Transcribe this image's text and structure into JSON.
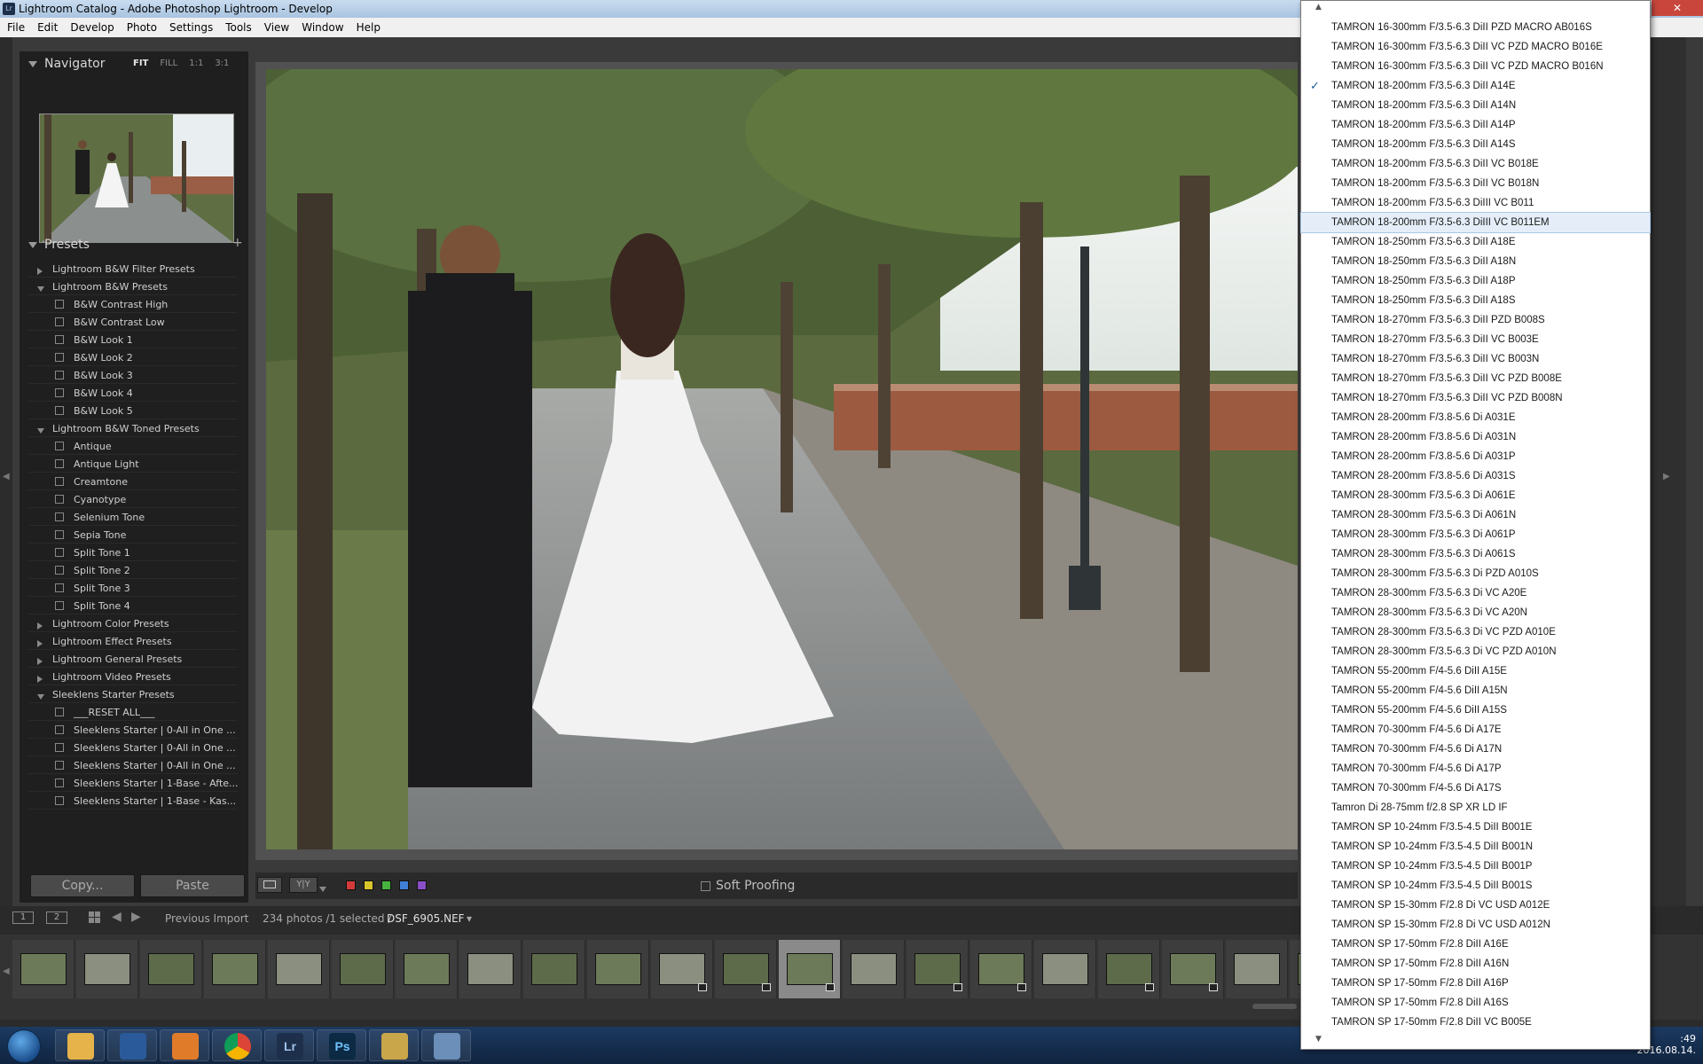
{
  "window": {
    "title": "Lightroom Catalog - Adobe Photoshop Lightroom - Develop",
    "app_icon": "Lr",
    "close_glyph": "✕"
  },
  "menu": [
    "File",
    "Edit",
    "Develop",
    "Photo",
    "Settings",
    "Tools",
    "View",
    "Window",
    "Help"
  ],
  "navigator": {
    "title": "Navigator",
    "modes": [
      "FIT",
      "FILL",
      "1:1",
      "3:1"
    ],
    "active_mode": "FIT"
  },
  "presets": {
    "title": "Presets",
    "add_glyph": "+",
    "rows": [
      {
        "kind": "folder",
        "open": false,
        "label": "Lightroom B&W Filter Presets"
      },
      {
        "kind": "folder",
        "open": true,
        "label": "Lightroom B&W Presets"
      },
      {
        "kind": "item",
        "label": "B&W Contrast High"
      },
      {
        "kind": "item",
        "label": "B&W Contrast Low"
      },
      {
        "kind": "item",
        "label": "B&W Look 1"
      },
      {
        "kind": "item",
        "label": "B&W Look 2"
      },
      {
        "kind": "item",
        "label": "B&W Look 3"
      },
      {
        "kind": "item",
        "label": "B&W Look 4"
      },
      {
        "kind": "item",
        "label": "B&W Look 5"
      },
      {
        "kind": "folder",
        "open": true,
        "label": "Lightroom B&W Toned Presets"
      },
      {
        "kind": "item",
        "label": "Antique"
      },
      {
        "kind": "item",
        "label": "Antique Light"
      },
      {
        "kind": "item",
        "label": "Creamtone"
      },
      {
        "kind": "item",
        "label": "Cyanotype"
      },
      {
        "kind": "item",
        "label": "Selenium Tone"
      },
      {
        "kind": "item",
        "label": "Sepia Tone"
      },
      {
        "kind": "item",
        "label": "Split Tone 1"
      },
      {
        "kind": "item",
        "label": "Split Tone 2"
      },
      {
        "kind": "item",
        "label": "Split Tone 3"
      },
      {
        "kind": "item",
        "label": "Split Tone 4"
      },
      {
        "kind": "folder",
        "open": false,
        "label": "Lightroom Color Presets"
      },
      {
        "kind": "folder",
        "open": false,
        "label": "Lightroom Effect Presets"
      },
      {
        "kind": "folder",
        "open": false,
        "label": "Lightroom General Presets"
      },
      {
        "kind": "folder",
        "open": false,
        "label": "Lightroom Video Presets"
      },
      {
        "kind": "folder",
        "open": true,
        "label": "Sleeklens Starter Presets"
      },
      {
        "kind": "item",
        "label": "___RESET ALL___"
      },
      {
        "kind": "item",
        "label": "Sleeklens Starter | 0-All in One ..."
      },
      {
        "kind": "item",
        "label": "Sleeklens Starter | 0-All in One ..."
      },
      {
        "kind": "item",
        "label": "Sleeklens Starter | 0-All in One ..."
      },
      {
        "kind": "item",
        "label": "Sleeklens Starter | 1-Base - Afte..."
      },
      {
        "kind": "item",
        "label": "Sleeklens Starter | 1-Base - Kas..."
      }
    ]
  },
  "buttons": {
    "copy": "Copy...",
    "paste": "Paste"
  },
  "toolbar": {
    "soft_proofing": "Soft Proofing",
    "view_yy": "Y|Y",
    "color_labels": [
      "#d33a3a",
      "#d8c52a",
      "#47b23e",
      "#3f7fd6",
      "#8a4fc8"
    ]
  },
  "filmstrip_bar": {
    "screen1": "1",
    "screen2": "2",
    "source": "Previous Import",
    "count": "234 photos /1 selected /",
    "filename": "DSF_6905.NEF",
    "dropdown_glyph": "▾"
  },
  "filmstrip": {
    "selected_index": 12,
    "badged": [
      10,
      11,
      12,
      14,
      15,
      17,
      18
    ]
  },
  "clock": {
    "time": ":49",
    "date": "2016.08.14."
  },
  "taskbar_icons": [
    "folder-icon",
    "save-icon",
    "media-player-icon",
    "chrome-icon",
    "lightroom-icon",
    "photoshop-icon",
    "paint-icon",
    "screenshot-icon"
  ],
  "taskbar_labels": {
    "lightroom": "Lr",
    "photoshop": "Ps"
  },
  "lens_dropdown": {
    "checked_index": 3,
    "hover_index": 10,
    "items": [
      "TAMRON 16-300mm F/3.5-6.3 DiII PZD MACRO AB016S",
      "TAMRON 16-300mm F/3.5-6.3 DiII VC PZD MACRO B016E",
      "TAMRON 16-300mm F/3.5-6.3 DiII VC PZD MACRO B016N",
      "TAMRON 18-200mm F/3.5-6.3 DiII A14E",
      "TAMRON 18-200mm F/3.5-6.3 DiII A14N",
      "TAMRON 18-200mm F/3.5-6.3 DiII A14P",
      "TAMRON 18-200mm F/3.5-6.3 DiII A14S",
      "TAMRON 18-200mm F/3.5-6.3 DiII VC B018E",
      "TAMRON 18-200mm F/3.5-6.3 DiII VC B018N",
      "TAMRON 18-200mm F/3.5-6.3 DiIII VC B011",
      "TAMRON 18-200mm F/3.5-6.3 DiIII VC B011EM",
      "TAMRON 18-250mm F/3.5-6.3 DiII A18E",
      "TAMRON 18-250mm F/3.5-6.3 DiII A18N",
      "TAMRON 18-250mm F/3.5-6.3 DiII A18P",
      "TAMRON 18-250mm F/3.5-6.3 DiII A18S",
      "TAMRON 18-270mm F/3.5-6.3 DiII PZD B008S",
      "TAMRON 18-270mm F/3.5-6.3 DiII VC B003E",
      "TAMRON 18-270mm F/3.5-6.3 DiII VC B003N",
      "TAMRON 18-270mm F/3.5-6.3 DiII VC PZD B008E",
      "TAMRON 18-270mm F/3.5-6.3 DiII VC PZD B008N",
      "TAMRON 28-200mm F/3.8-5.6 Di A031E",
      "TAMRON 28-200mm F/3.8-5.6 Di A031N",
      "TAMRON 28-200mm F/3.8-5.6 Di A031P",
      "TAMRON 28-200mm F/3.8-5.6 Di A031S",
      "TAMRON 28-300mm F/3.5-6.3 Di A061E",
      "TAMRON 28-300mm F/3.5-6.3 Di A061N",
      "TAMRON 28-300mm F/3.5-6.3 Di A061P",
      "TAMRON 28-300mm F/3.5-6.3 Di A061S",
      "TAMRON 28-300mm F/3.5-6.3 Di PZD A010S",
      "TAMRON 28-300mm F/3.5-6.3 Di VC A20E",
      "TAMRON 28-300mm F/3.5-6.3 Di VC A20N",
      "TAMRON 28-300mm F/3.5-6.3 Di VC PZD A010E",
      "TAMRON 28-300mm F/3.5-6.3 Di VC PZD A010N",
      "TAMRON 55-200mm F/4-5.6 DiII A15E",
      "TAMRON 55-200mm F/4-5.6 DiII A15N",
      "TAMRON 55-200mm F/4-5.6 DiII A15S",
      "TAMRON 70-300mm F/4-5.6 Di A17E",
      "TAMRON 70-300mm F/4-5.6 Di A17N",
      "TAMRON 70-300mm F/4-5.6 Di A17P",
      "TAMRON 70-300mm F/4-5.6 Di A17S",
      "Tamron Di 28-75mm f/2.8 SP XR LD IF",
      "TAMRON SP 10-24mm F/3.5-4.5 DiII B001E",
      "TAMRON SP 10-24mm F/3.5-4.5 DiII B001N",
      "TAMRON SP 10-24mm F/3.5-4.5 DiII B001P",
      "TAMRON SP 10-24mm F/3.5-4.5 DiII B001S",
      "TAMRON SP 15-30mm F/2.8 Di VC USD A012E",
      "TAMRON SP 15-30mm F/2.8 Di VC USD A012N",
      "TAMRON SP 17-50mm F/2.8 DiII A16E",
      "TAMRON SP 17-50mm F/2.8 DiII A16N",
      "TAMRON SP 17-50mm F/2.8 DiII A16P",
      "TAMRON SP 17-50mm F/2.8 DiII A16S",
      "TAMRON SP 17-50mm F/2.8 DiII VC B005E"
    ]
  }
}
